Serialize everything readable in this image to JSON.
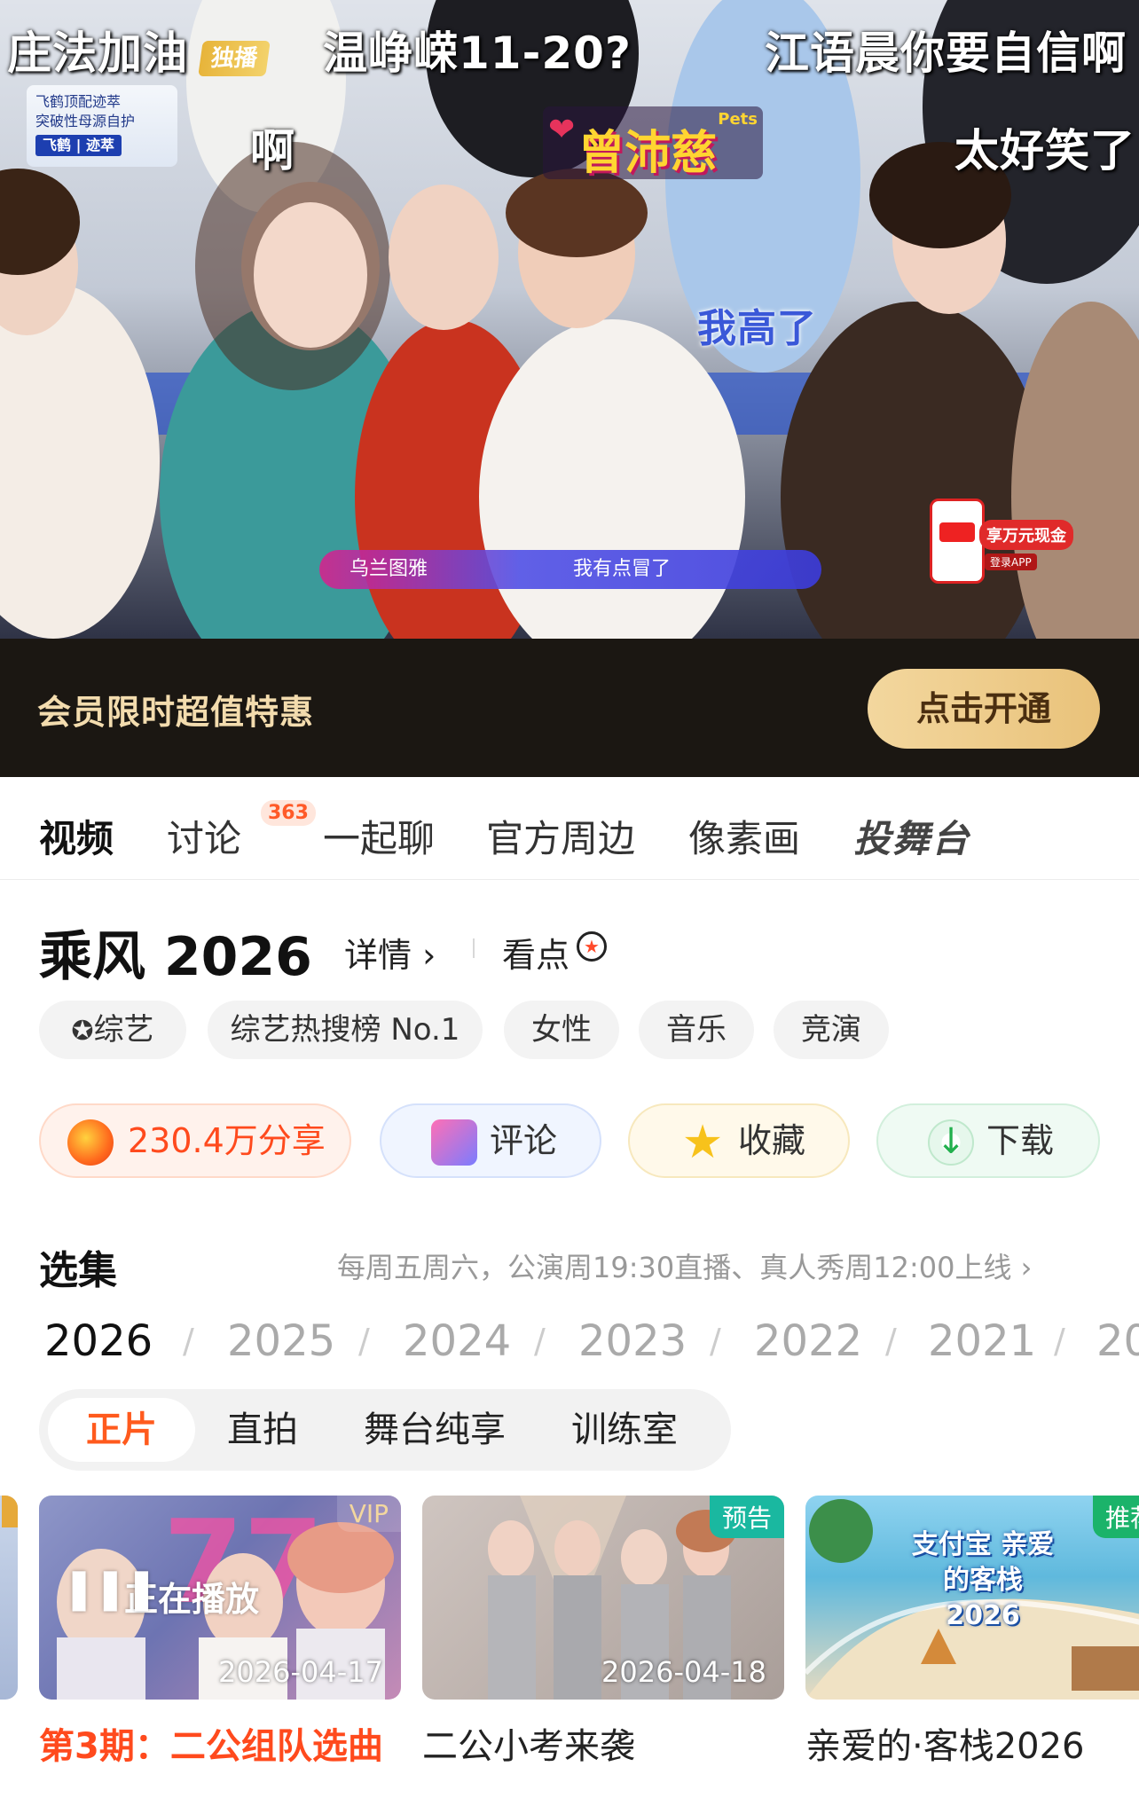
{
  "video": {
    "danmu": [
      "庄法加油",
      "温峥嵘11-20?",
      "江语晨你要自信啊",
      "啊",
      "太好笑了",
      "我高了"
    ],
    "channel_badge": "独播",
    "ad": {
      "line1": "飞鹤顶配迹萃",
      "line2": "突破性母源自护",
      "brand": "飞鹤 | 迹萃"
    },
    "name_tag": "曾沛慈",
    "name_tag_small": "Pets",
    "lower_third": {
      "name": "乌兰图雅",
      "quote": "我有点冒了"
    },
    "promo": {
      "cash": "享万元现金",
      "login": "登录APP"
    }
  },
  "vip_banner": {
    "text": "会员限时超值特惠",
    "button": "点击开通"
  },
  "tabs": [
    {
      "label": "视频",
      "active": true
    },
    {
      "label": "讨论",
      "badge": "363"
    },
    {
      "label": "一起聊"
    },
    {
      "label": "官方周边"
    },
    {
      "label": "像素画"
    },
    {
      "label": "投舞台"
    }
  ],
  "show": {
    "title": "乘风 2026",
    "detail": "详情 ›",
    "highlight": "看点"
  },
  "tags": [
    "综艺",
    "综艺热搜榜 No.1",
    "女性",
    "音乐",
    "竞演"
  ],
  "actions": {
    "share": "230.4万分享",
    "comment": "评论",
    "favorite": "收藏",
    "download": "下载"
  },
  "episodes": {
    "title": "选集",
    "schedule": "每周五周六，公演周19:30直播、真人秀周12:00上线 ›",
    "years": [
      "2026",
      "2025",
      "2024",
      "2023",
      "2022",
      "2021",
      "20"
    ],
    "subtabs": [
      "正片",
      "直拍",
      "舞台纯享",
      "训练室"
    ],
    "cards": [
      {
        "corner": "VIP",
        "status": "正在播放",
        "date": "2026-04-17",
        "caption": "第3期：二公组队选曲"
      },
      {
        "corner": "预告",
        "date": "2026-04-18",
        "caption": "二公小考来袭"
      },
      {
        "corner": "推荐",
        "caption": "亲爱的·客栈2026",
        "thumb_text": "支付宝 亲爱的客栈 2026"
      }
    ]
  },
  "colors": {
    "accent": "#ff4a1d",
    "vip_gold": "#f3dcae",
    "banner_bg": "#1b1712"
  }
}
